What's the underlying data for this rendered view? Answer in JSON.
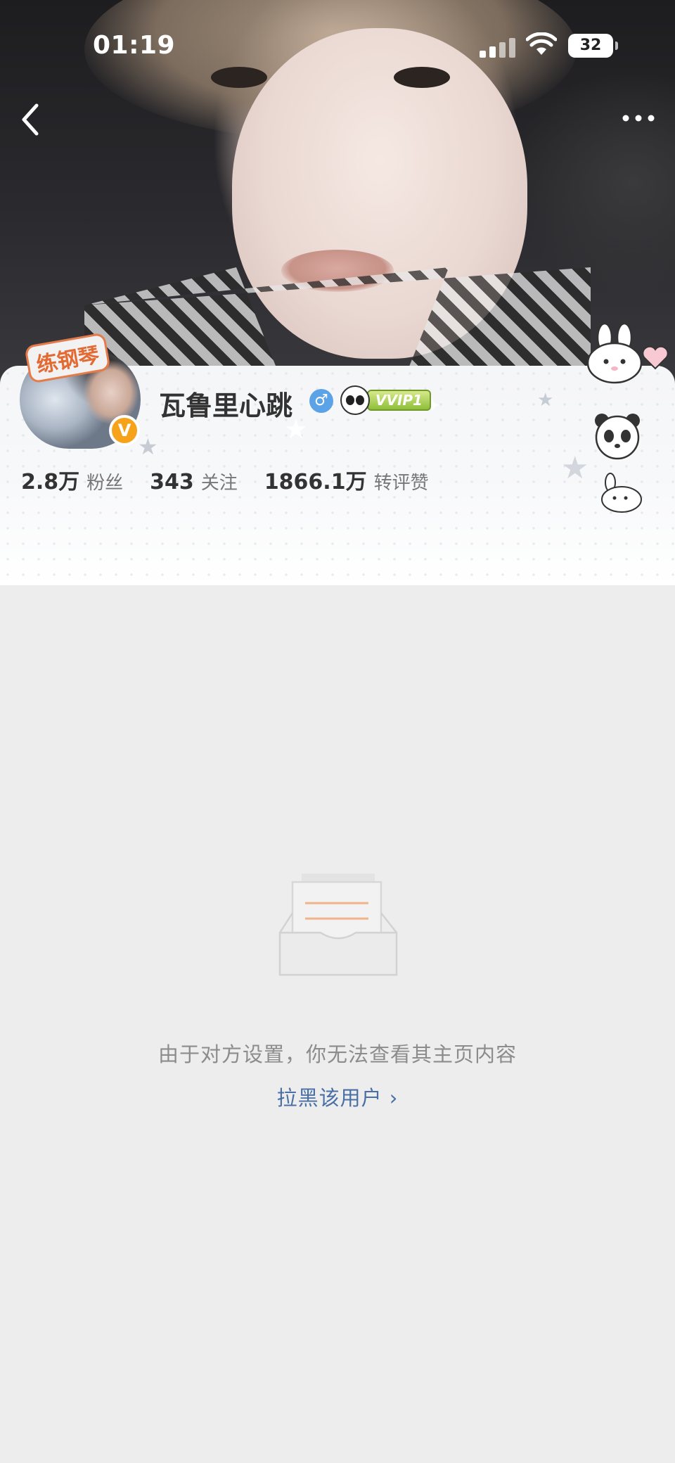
{
  "status_bar": {
    "time": "01:19",
    "battery": "32"
  },
  "nav": {
    "back_icon": "chevron-left-icon",
    "more_icon": "more-horizontal-icon"
  },
  "profile": {
    "avatar_sticker_text": "练钢琴",
    "verified_badge": "V",
    "name": "瓦鲁里心跳",
    "gender_symbol": "♂",
    "vip_label": "VVIP1",
    "stats": [
      {
        "value": "2.8万",
        "label": "粉丝"
      },
      {
        "value": "343",
        "label": "关注"
      },
      {
        "value": "1866.1万",
        "label": "转评赞"
      }
    ]
  },
  "empty_state": {
    "message": "由于对方设置，你无法查看其主页内容",
    "action": "拉黑该用户 ›"
  },
  "colors": {
    "page_background": "#ededed",
    "link": "#4a6fa5",
    "verified": "#f7a21b",
    "gender": "#5ba3e6",
    "vip": "#8fbf3a"
  }
}
